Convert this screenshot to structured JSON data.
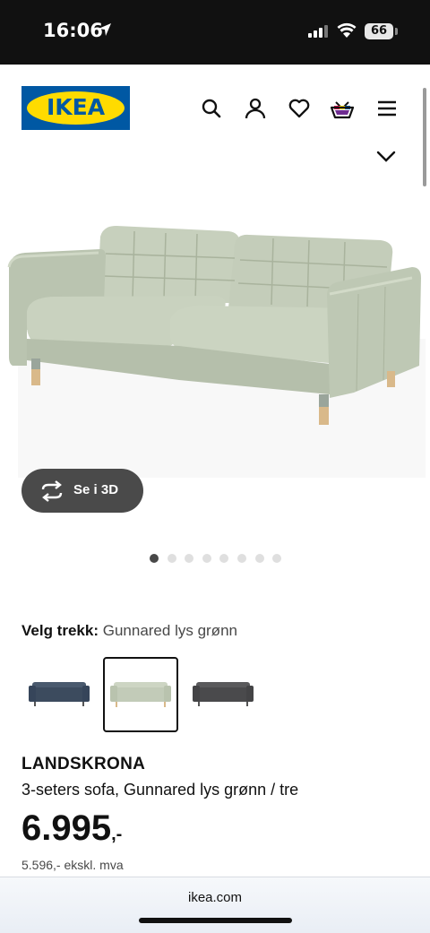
{
  "status_bar": {
    "time": "16:06",
    "battery": "66"
  },
  "brand": {
    "logo_text": "IKEA",
    "blue": "#0058a3",
    "yellow": "#ffdb00"
  },
  "header": {
    "icons": [
      "search-icon",
      "account-icon",
      "heart-icon",
      "cart-icon",
      "menu-icon"
    ]
  },
  "gallery": {
    "button_3d_label": "Se i 3D",
    "dots_count": 8,
    "active_dot": 1
  },
  "variant": {
    "label": "Velg trekk:",
    "value": "Gunnared lys grønn",
    "swatches": [
      "dark-blue-sofa",
      "light-green-sofa",
      "dark-grey-sofa"
    ],
    "selected_index": 1
  },
  "product": {
    "name": "LANDSKRONA",
    "description": "3-seters sofa, Gunnared lys grønn / tre",
    "price": "6.995",
    "price_suffix": ",-",
    "price_ex_vat": "5.596,- ekskl. mva"
  },
  "browser": {
    "url": "ikea.com"
  }
}
